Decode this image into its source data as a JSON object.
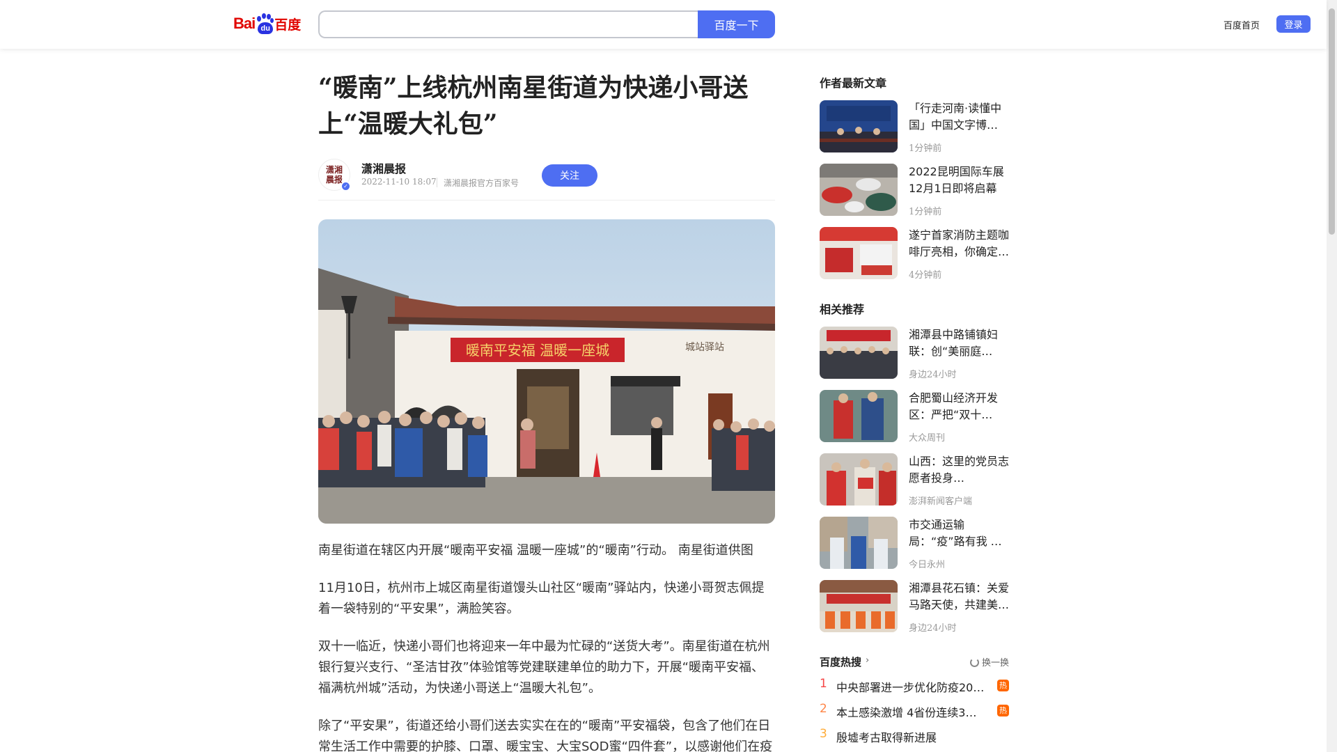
{
  "header": {
    "logo_bai": "Bai",
    "logo_du": "du",
    "logo_cn": "百度",
    "search_value": "",
    "search_button": "百度一下",
    "nav_home": "百度首页",
    "login": "登录"
  },
  "article": {
    "title": "“暖南”上线杭州南星街道为快递小哥送上“温暖大礼包”",
    "author": {
      "avatar_text": "潇湘晨报",
      "name": "潇湘晨报",
      "time": "2022-11-10 18:07",
      "source": "潇湘晨报官方百家号",
      "follow": "关注"
    },
    "photo_banner": "暖南平安福  温暖一座城",
    "photo_sign": "城站驿站",
    "paragraphs": [
      "南星街道在辖区内开展“暖南平安福 温暖一座城”的“暖南”行动。 南星街道供图",
      "11月10日，杭州市上城区南星街道馒头山社区“暖南”驿站内，快递小哥贺志佩提着一袋特别的“平安果”，满脸笑容。",
      "双十一临近，快递小哥们也将迎来一年中最为忙碌的“送货大考”。南星街道在杭州银行复兴支行、“圣洁甘孜”体验馆等党建联建单位的助力下，开展“暖南平安福、福满杭州城”活动，为快递小哥送上“温暖大礼包”。",
      "除了“平安果”，街道还给小哥们送去实实在在的“暖南”平安福袋，包含了他们在日常生活工作中需要的护膝、口罩、暖宝宝、大宝SOD蜜“四件套”，以感谢他们在疫情"
    ]
  },
  "sidebar": {
    "latest_title": "作者最新文章",
    "latest": [
      {
        "title": "「行走河南·读懂中国」中国文字博物馆…",
        "meta": "1分钟前"
      },
      {
        "title": "2022昆明国际车展12月1日即将启幕",
        "meta": "1分钟前"
      },
      {
        "title": "遂宁首家消防主题咖啡厅亮相，你确定…",
        "meta": "4分钟前"
      }
    ],
    "related_title": "相关推荐",
    "related": [
      {
        "title": "湘潭县中路铺镇妇联：创“美丽庭院”…",
        "meta": "身边24小时"
      },
      {
        "title": "合肥蜀山经济开发区：严把“双十一”…",
        "meta": "大众周刊"
      },
      {
        "title": "山西：这里的党员志愿者投身战“疫”一…",
        "meta": "澎湃新闻客户端"
      },
      {
        "title": "市交通运输局：“疫”路有我 …",
        "meta": "今日永州"
      },
      {
        "title": "湘潭县花石镇：关爱马路天使，共建美…",
        "meta": "身边24小时"
      }
    ],
    "hot": {
      "title": "百度热搜",
      "arrow": "›",
      "refresh": "换一换",
      "items": [
        {
          "rank": "1",
          "text": "中央部署进一步优化防疫20…",
          "badge": "热"
        },
        {
          "rank": "2",
          "text": "本土感染激增 4省份连续3天…",
          "badge": "热"
        },
        {
          "rank": "3",
          "text": "殷墟考古取得新进展",
          "badge": ""
        }
      ]
    }
  },
  "colors": {
    "accent": "#4e6ef2",
    "rank1": "#f54545",
    "rank2": "#ff8547",
    "rank3": "#ffac38",
    "hot_badge": "#ff6600"
  }
}
